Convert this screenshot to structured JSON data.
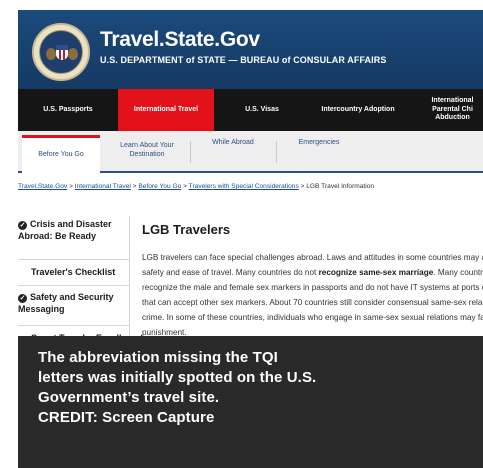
{
  "header": {
    "site_title": "Travel.State.Gov",
    "site_subtitle": "U.S. DEPARTMENT of STATE — BUREAU of CONSULAR AFFAIRS",
    "seal_icon": "department-of-state-seal-icon"
  },
  "nav": {
    "items": [
      {
        "label": "U.S. Passports",
        "active": false
      },
      {
        "label": "International Travel",
        "active": true
      },
      {
        "label": "U.S. Visas",
        "active": false
      },
      {
        "label": "Intercountry Adoption",
        "active": false
      },
      {
        "label": "International Parental Chi Abduction",
        "active": false
      }
    ],
    "active_color": "#e3111a"
  },
  "subtabs": {
    "items": [
      {
        "label": "Before You Go",
        "active": true
      },
      {
        "label": "Learn About Your Destination",
        "active": false
      },
      {
        "label": "While Abroad",
        "active": false
      },
      {
        "label": "Emergencies",
        "active": false
      }
    ]
  },
  "breadcrumb": {
    "links": [
      "Travel.State.Gov",
      "International Travel",
      "Before You Go",
      "Travelers with Special Considerations"
    ],
    "separator": " > ",
    "current": "LGB Travel Information"
  },
  "sidebar": {
    "items": [
      {
        "label": "Crisis and Disaster Abroad: Be Ready",
        "checked": true
      },
      {
        "label": "Traveler's Checklist",
        "checked": false
      },
      {
        "label": "Safety and Security Messaging",
        "checked": true
      },
      {
        "label": "Smart Traveler Enrollment",
        "checked": false
      }
    ]
  },
  "article": {
    "title": "LGB Travelers",
    "body_lines": [
      {
        "text": "LGB travelers can face special challenges abroad. Laws and attitudes in some countries may a"
      },
      {
        "text": "safety and ease of travel. Many countries do not ",
        "bold": "recognize same-sex marriage",
        "after": ". Many countrie"
      },
      {
        "text": "recognize the male and female sex markers in passports and do not have IT systems at ports o"
      },
      {
        "text": "that can accept other sex markers. About 70 countries still consider consensual same-sex rela"
      },
      {
        "text": "crime. In some of these countries, individuals who engage in same-sex sexual relations may fa"
      },
      {
        "text": "punishment."
      }
    ]
  },
  "caption": {
    "lines": [
      "The abbreviation missing the TQI",
      "letters was initially spotted on the U.S.",
      "Government’s travel site.",
      "CREDIT: Screen Capture"
    ]
  }
}
